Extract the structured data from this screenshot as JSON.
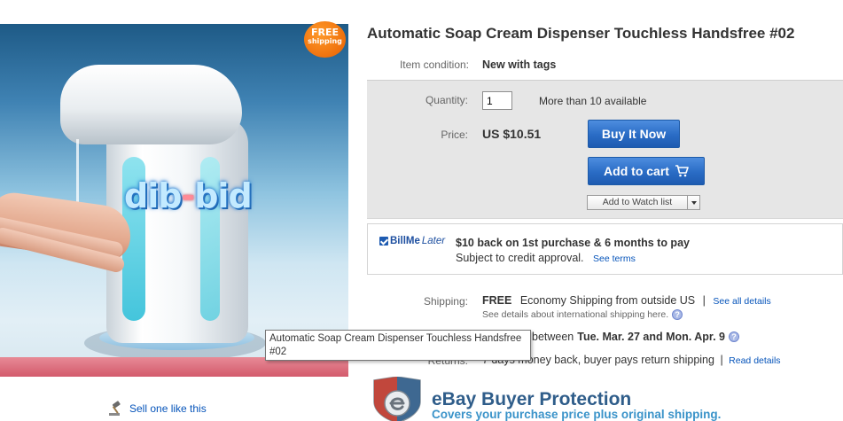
{
  "product_image": {
    "watermark_left": "dib",
    "watermark_dash": "-",
    "watermark_right": "bid",
    "badge_line1": "FREE",
    "badge_line2": "shipping"
  },
  "sell_like": {
    "label": "Sell one like this",
    "icon": "gavel-icon"
  },
  "item": {
    "title": "Automatic Soap Cream Dispenser Touchless Handsfree #02",
    "condition_label": "Item condition:",
    "condition_value": "New with tags"
  },
  "purchase": {
    "quantity_label": "Quantity:",
    "quantity_value": "1",
    "available_text": "More than 10 available",
    "price_label": "Price:",
    "price_value": "US $10.51",
    "buy_now_label": "Buy It Now",
    "add_to_cart_label": "Add to cart",
    "watch_label": "Add to Watch list"
  },
  "bill_me_later": {
    "logo_bill": "BillMe",
    "logo_later": "Later",
    "headline": "$10 back on 1st purchase & 6 months to pay",
    "subtext": "Subject to credit approval.",
    "terms_link": "See terms"
  },
  "shipping": {
    "label": "Shipping:",
    "free": "FREE",
    "method": "Economy Shipping from outside US",
    "separator": "|",
    "see_all": "See all details",
    "international_note": "See details about international shipping here.",
    "delivery_prefix": "between",
    "delivery_range": "Tue. Mar. 27 and Mon. Apr. 9"
  },
  "returns": {
    "label": "Returns:",
    "text": "7 days money back, buyer pays return shipping",
    "separator": "|",
    "link": "Read details"
  },
  "tooltip": {
    "text": "Automatic Soap Cream Dispenser Touchless Handsfree #02"
  },
  "buyer_protection": {
    "title": "eBay Buyer Protection",
    "subtitle": "Covers your purchase price plus original shipping."
  },
  "colors": {
    "link": "#0654ba",
    "button_blue": "#2a6cc5",
    "badge_orange": "#ef6c00",
    "protection_title": "#2f5d8a",
    "protection_sub": "#3a93c9"
  }
}
